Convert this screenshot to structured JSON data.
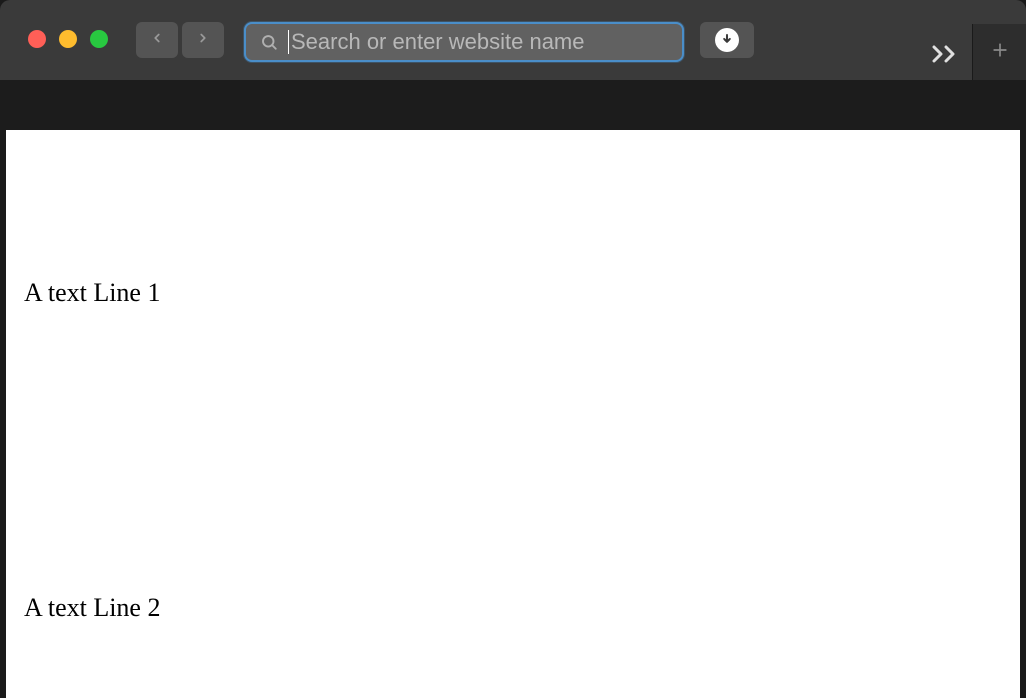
{
  "toolbar": {
    "search_placeholder": "Search or enter website name"
  },
  "content": {
    "line1": "A text Line 1",
    "line2": "A text Line 2"
  },
  "icons": {
    "close": "close-icon",
    "minimize": "minimize-icon",
    "maximize": "maximize-icon",
    "back": "chevron-left-icon",
    "forward": "chevron-right-icon",
    "search": "search-icon",
    "download": "download-icon",
    "overflow": "overflow-icon",
    "newtab": "plus-icon"
  },
  "colors": {
    "close": "#ff5f57",
    "minimize": "#febc2e",
    "maximize": "#28c840",
    "address_border": "#4a8ec9",
    "chrome_bg": "#3a3a3a",
    "button_bg": "#545454"
  }
}
